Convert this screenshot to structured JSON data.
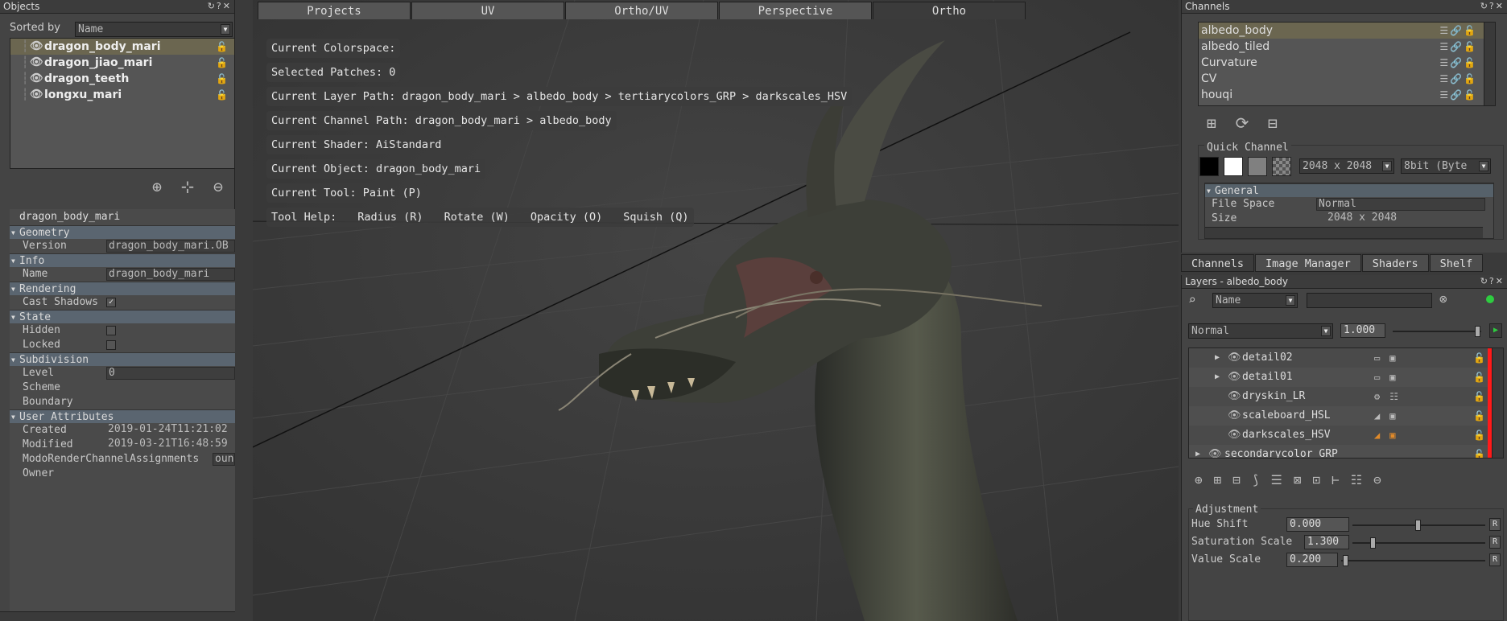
{
  "objects_panel": {
    "title": "Objects",
    "sorted_by_label": "Sorted by",
    "sort_value": "Name",
    "objects": [
      {
        "name": "dragon_body_mari",
        "selected": true
      },
      {
        "name": "dragon_jiao_mari",
        "selected": false
      },
      {
        "name": "dragon_teeth",
        "selected": false
      },
      {
        "name": "longxu_mari",
        "selected": false
      }
    ],
    "toolbar_icons": [
      "add-object-icon",
      "add-locator-icon",
      "remove-object-icon"
    ]
  },
  "attributes": {
    "header": "dragon_body_mari",
    "sections": {
      "geometry": "Geometry",
      "info": "Info",
      "rendering": "Rendering",
      "state": "State",
      "subdivision": "Subdivision",
      "user_attributes": "User Attributes"
    },
    "version_label": "Version",
    "version_value": "dragon_body_mari.OB",
    "name_label": "Name",
    "name_value": "dragon_body_mari",
    "cast_shadows_label": "Cast Shadows",
    "cast_shadows_check": "✓",
    "hidden_label": "Hidden",
    "locked_label": "Locked",
    "level_label": "Level",
    "level_value": "0",
    "scheme_label": "Scheme",
    "boundary_label": "Boundary",
    "created_label": "Created",
    "created_value": "2019-01-24T11:21:02",
    "modified_label": "Modified",
    "modified_value": "2019-03-21T16:48:59",
    "modo_label": "ModoRenderChannelAssignments",
    "modo_value": "oun",
    "owner_label": "Owner"
  },
  "viewport": {
    "tabs": [
      "Projects",
      "UV",
      "Ortho/UV",
      "Perspective",
      "Ortho"
    ],
    "active_tab": "Ortho",
    "overlay": {
      "colorspace": "Current Colorspace:",
      "patches": "Selected Patches: 0",
      "layer_path": "Current Layer Path: dragon_body_mari > albedo_body > tertiarycolors_GRP > darkscales_HSV",
      "channel_path": "Current Channel Path: dragon_body_mari > albedo_body",
      "shader": "Current Shader: AiStandard",
      "object": "Current Object: dragon_body_mari",
      "tool": "Current Tool: Paint (P)",
      "tool_help": "Tool Help:",
      "help_radius": "Radius (R)",
      "help_rotate": "Rotate (W)",
      "help_opacity": "Opacity (O)",
      "help_squish": "Squish (Q)"
    }
  },
  "channels_panel": {
    "title": "Channels",
    "channels": [
      {
        "name": "albedo_body",
        "selected": true
      },
      {
        "name": "albedo_tiled",
        "selected": false
      },
      {
        "name": "Curvature",
        "selected": false
      },
      {
        "name": "CV",
        "selected": false
      },
      {
        "name": "houqi",
        "selected": false
      }
    ],
    "quick_channel_label": "Quick Channel",
    "resolution": "2048 x 2048",
    "depth": "8bit (Byte",
    "general_label": "General",
    "file_space_label": "File Space",
    "file_space_value": "Normal",
    "size_label": "Size",
    "size_value": "2048 x 2048"
  },
  "right_tabs": [
    "Channels",
    "Image Manager",
    "Shaders",
    "Shelf"
  ],
  "layers_panel": {
    "title": "Layers - albedo_body",
    "filter_field": "Name",
    "blend_mode": "Normal",
    "opacity": "1.000",
    "layers": [
      {
        "name": "detail02",
        "expand": true
      },
      {
        "name": "detail01",
        "expand": true
      },
      {
        "name": "dryskin_LR",
        "expand": false
      },
      {
        "name": "scaleboard_HSL",
        "expand": false
      },
      {
        "name": "darkscales_HSV",
        "expand": false
      },
      {
        "name": "secondarycolor_GRP",
        "expand": true
      }
    ],
    "adjustment_label": "Adjustment",
    "hue_label": "Hue Shift",
    "hue_value": "0.000",
    "sat_label": "Saturation Scale",
    "sat_value": "1.300",
    "val_label": "Value Scale",
    "val_value": "0.200",
    "reset_label": "R"
  },
  "colors": {
    "selection": "#6b6650",
    "panel": "#444444",
    "viewport_bg": "#3b3b3b",
    "accent_red": "#ff1a1a",
    "accent_green": "#2ecc40"
  }
}
